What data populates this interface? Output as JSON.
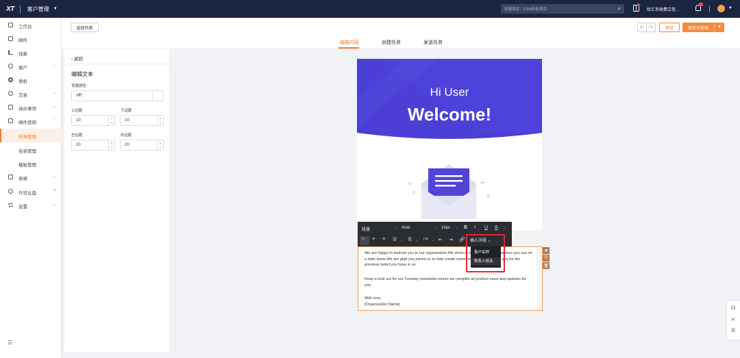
{
  "topbar": {
    "logo": "XT",
    "app_title": "客户管理",
    "search_placeholder": "所属类目：CRM所有类目",
    "company": "哈汇手续费立签...",
    "colors": {
      "bg": "#1b2540",
      "accent": "#f07d2c"
    }
  },
  "sidebar": {
    "items": [
      {
        "label": "工作台",
        "icon": "monitor-icon"
      },
      {
        "label": "邮件",
        "icon": "mail-icon"
      },
      {
        "label": "线索",
        "icon": "bar-icon"
      },
      {
        "label": "客户",
        "icon": "user-icon"
      },
      {
        "label": "商机",
        "icon": "target-icon"
      },
      {
        "label": "交易",
        "icon": "clock-icon"
      },
      {
        "label": "待办事项",
        "icon": "calendar-icon"
      },
      {
        "label": "邮件营销",
        "icon": "campaign-icon"
      },
      {
        "label": "任务管理",
        "icon": ""
      },
      {
        "label": "名单管理",
        "icon": ""
      },
      {
        "label": "模板管理",
        "icon": ""
      },
      {
        "label": "表格",
        "icon": "table-icon"
      },
      {
        "label": "外贸云盘",
        "icon": "cloud-icon"
      },
      {
        "label": "设置",
        "icon": "gear-icon"
      }
    ]
  },
  "header": {
    "back_list": "返回列表",
    "tabs": [
      "编辑内容",
      "创建任务",
      "发送任务"
    ],
    "preview": "预览",
    "save": "保存为草稿"
  },
  "left_panel": {
    "back": "返回",
    "title": "编辑文本",
    "bg_color_label": "背景颜色",
    "bg_color_value": "#fff",
    "top_label": "上边距",
    "top_value": "10",
    "bottom_label": "下边距",
    "bottom_value": "10",
    "left_label": "左边距",
    "left_value": "20",
    "right_label": "右边距",
    "right_value": "20"
  },
  "email": {
    "hero_line1": "Hi User",
    "hero_line2": "Welcome!",
    "hero_color": "#4b3fd6",
    "paragraph1": "We are happy to welcom you to our organization.We strive to add value for the services you use on a daily basis.We are glad you joined us to help create something great.We thank you for the priceless belief you have in us.",
    "paragraph2": "Keep a look out for our Tuesday newsletter,where we complile all product news and updates for you.",
    "closing": "With love,",
    "signature": "[Organization Name]"
  },
  "toolbar": {
    "paragraph": "段落",
    "font": "Arial",
    "size": "14px",
    "insert_field": "插入字段",
    "field_options": [
      "客户名称",
      "联系人姓名"
    ]
  }
}
